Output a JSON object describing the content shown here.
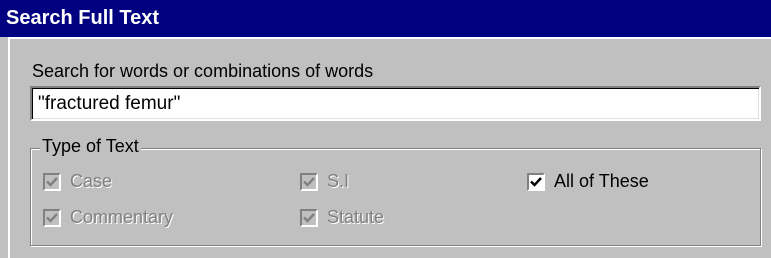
{
  "window": {
    "title": "Search Full Text"
  },
  "search": {
    "label": "Search for words or combinations of words",
    "value": "\"fractured femur\""
  },
  "type_of_text": {
    "legend": "Type of Text",
    "options": [
      {
        "label": "Case",
        "checked": true,
        "enabled": false
      },
      {
        "label": "Commentary",
        "checked": true,
        "enabled": false
      },
      {
        "label": "S.I",
        "checked": true,
        "enabled": false
      },
      {
        "label": "Statute",
        "checked": true,
        "enabled": false
      },
      {
        "label": "All of These",
        "checked": true,
        "enabled": true
      }
    ]
  },
  "colors": {
    "title_bar": "#000080",
    "dialog_background": "#c0c0c0",
    "disabled_text": "#808080"
  }
}
